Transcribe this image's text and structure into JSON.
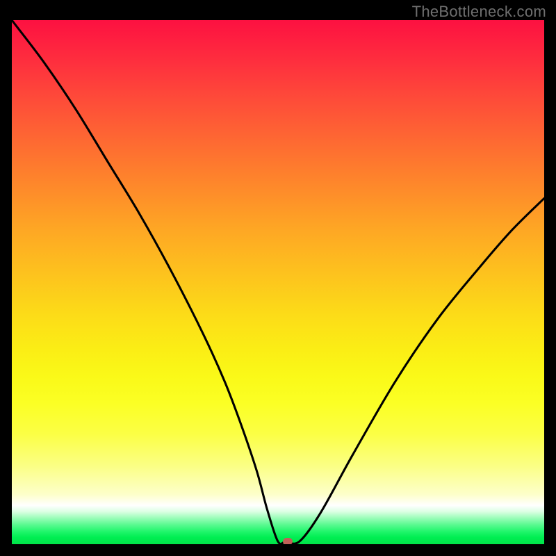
{
  "watermark": "TheBottleneck.com",
  "chart_data": {
    "type": "line",
    "title": "",
    "xlabel": "",
    "ylabel": "",
    "xlim": [
      0,
      100
    ],
    "ylim": [
      0,
      100
    ],
    "series": [
      {
        "name": "curve",
        "x": [
          0,
          6,
          12,
          18,
          24,
          30,
          36,
          40,
          43,
          46,
          48,
          50,
          51.5,
          54,
          58,
          64,
          72,
          80,
          88,
          94,
          100
        ],
        "y": [
          100,
          92,
          83,
          73,
          63,
          52,
          40,
          31,
          23,
          14,
          6.5,
          0.5,
          0.5,
          0.5,
          6,
          17,
          31,
          43,
          53,
          60,
          66
        ]
      }
    ],
    "marker": {
      "x": 51.8,
      "y": 0.55
    },
    "gradient_stops": [
      {
        "pos": 0,
        "color": "#fd1141"
      },
      {
        "pos": 50,
        "color": "#fdc11e"
      },
      {
        "pos": 70,
        "color": "#fbf616"
      },
      {
        "pos": 92,
        "color": "#ffffff"
      },
      {
        "pos": 100,
        "color": "#00e349"
      }
    ]
  }
}
